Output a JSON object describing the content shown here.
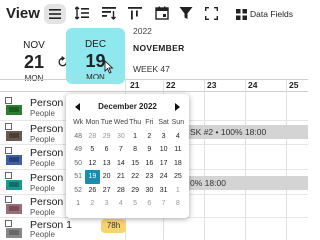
{
  "toolbar": {
    "view_label": "View",
    "data_fields_label": "Data Fields",
    "icons": [
      "menu-icon",
      "expand-rows-icon",
      "sort-icon",
      "sort-desc-icon",
      "calendar-icon",
      "filter-icon",
      "fullscreen-icon",
      "data-fields-icon"
    ]
  },
  "date_selector": {
    "prev": {
      "month": "NOV",
      "day": "21",
      "dow": "MON"
    },
    "current": {
      "month": "DEC",
      "day": "19",
      "dow": "MON"
    },
    "year": "2022",
    "month_name": "NOVEMBER",
    "week": "WEEK 47"
  },
  "timeline": {
    "days": [
      "21",
      "22",
      "23",
      "24",
      "25"
    ]
  },
  "resources": [
    {
      "name": "Person",
      "role": "People"
    },
    {
      "name": "Person",
      "role": "People"
    },
    {
      "name": "Person",
      "role": "People"
    },
    {
      "name": "Person",
      "role": "People"
    },
    {
      "name": "Person",
      "role": "People"
    },
    {
      "name": "Person 1",
      "role": "People"
    }
  ],
  "tasks": {
    "row2": "SK #2 • 100% 18:00",
    "row4": "0% 18:00",
    "hours_badge": "78h"
  },
  "picker": {
    "title": "December 2022",
    "headers": [
      "Wk",
      "Mon",
      "Tue",
      "Wed",
      "Thu",
      "Fri",
      "Sat",
      "Sun"
    ],
    "weeks": [
      {
        "wk": "48",
        "days": [
          "28",
          "29",
          "30",
          "1",
          "2",
          "3",
          "4"
        ],
        "muted": [
          true,
          true,
          true,
          false,
          false,
          false,
          false
        ]
      },
      {
        "wk": "49",
        "days": [
          "5",
          "6",
          "7",
          "8",
          "9",
          "10",
          "11"
        ],
        "muted": [
          false,
          false,
          false,
          false,
          false,
          false,
          false
        ]
      },
      {
        "wk": "50",
        "days": [
          "12",
          "13",
          "14",
          "15",
          "16",
          "17",
          "18"
        ],
        "muted": [
          false,
          false,
          false,
          false,
          false,
          false,
          false
        ]
      },
      {
        "wk": "51",
        "days": [
          "19",
          "20",
          "21",
          "22",
          "23",
          "24",
          "25"
        ],
        "muted": [
          false,
          false,
          false,
          false,
          false,
          false,
          false
        ]
      },
      {
        "wk": "52",
        "days": [
          "26",
          "27",
          "28",
          "29",
          "30",
          "31",
          "1"
        ],
        "muted": [
          false,
          false,
          false,
          false,
          false,
          false,
          true
        ]
      },
      {
        "wk": "1",
        "days": [
          "2",
          "3",
          "4",
          "5",
          "6",
          "7",
          "8"
        ],
        "muted": [
          true,
          true,
          true,
          true,
          true,
          true,
          true
        ]
      }
    ],
    "selected": "19"
  },
  "colors": {
    "selected_date_bg": "#8fe8ee",
    "picker_selected": "#1a8cb0",
    "task_bar": "#d4d4d4",
    "hours_badge": "#f8d470"
  }
}
